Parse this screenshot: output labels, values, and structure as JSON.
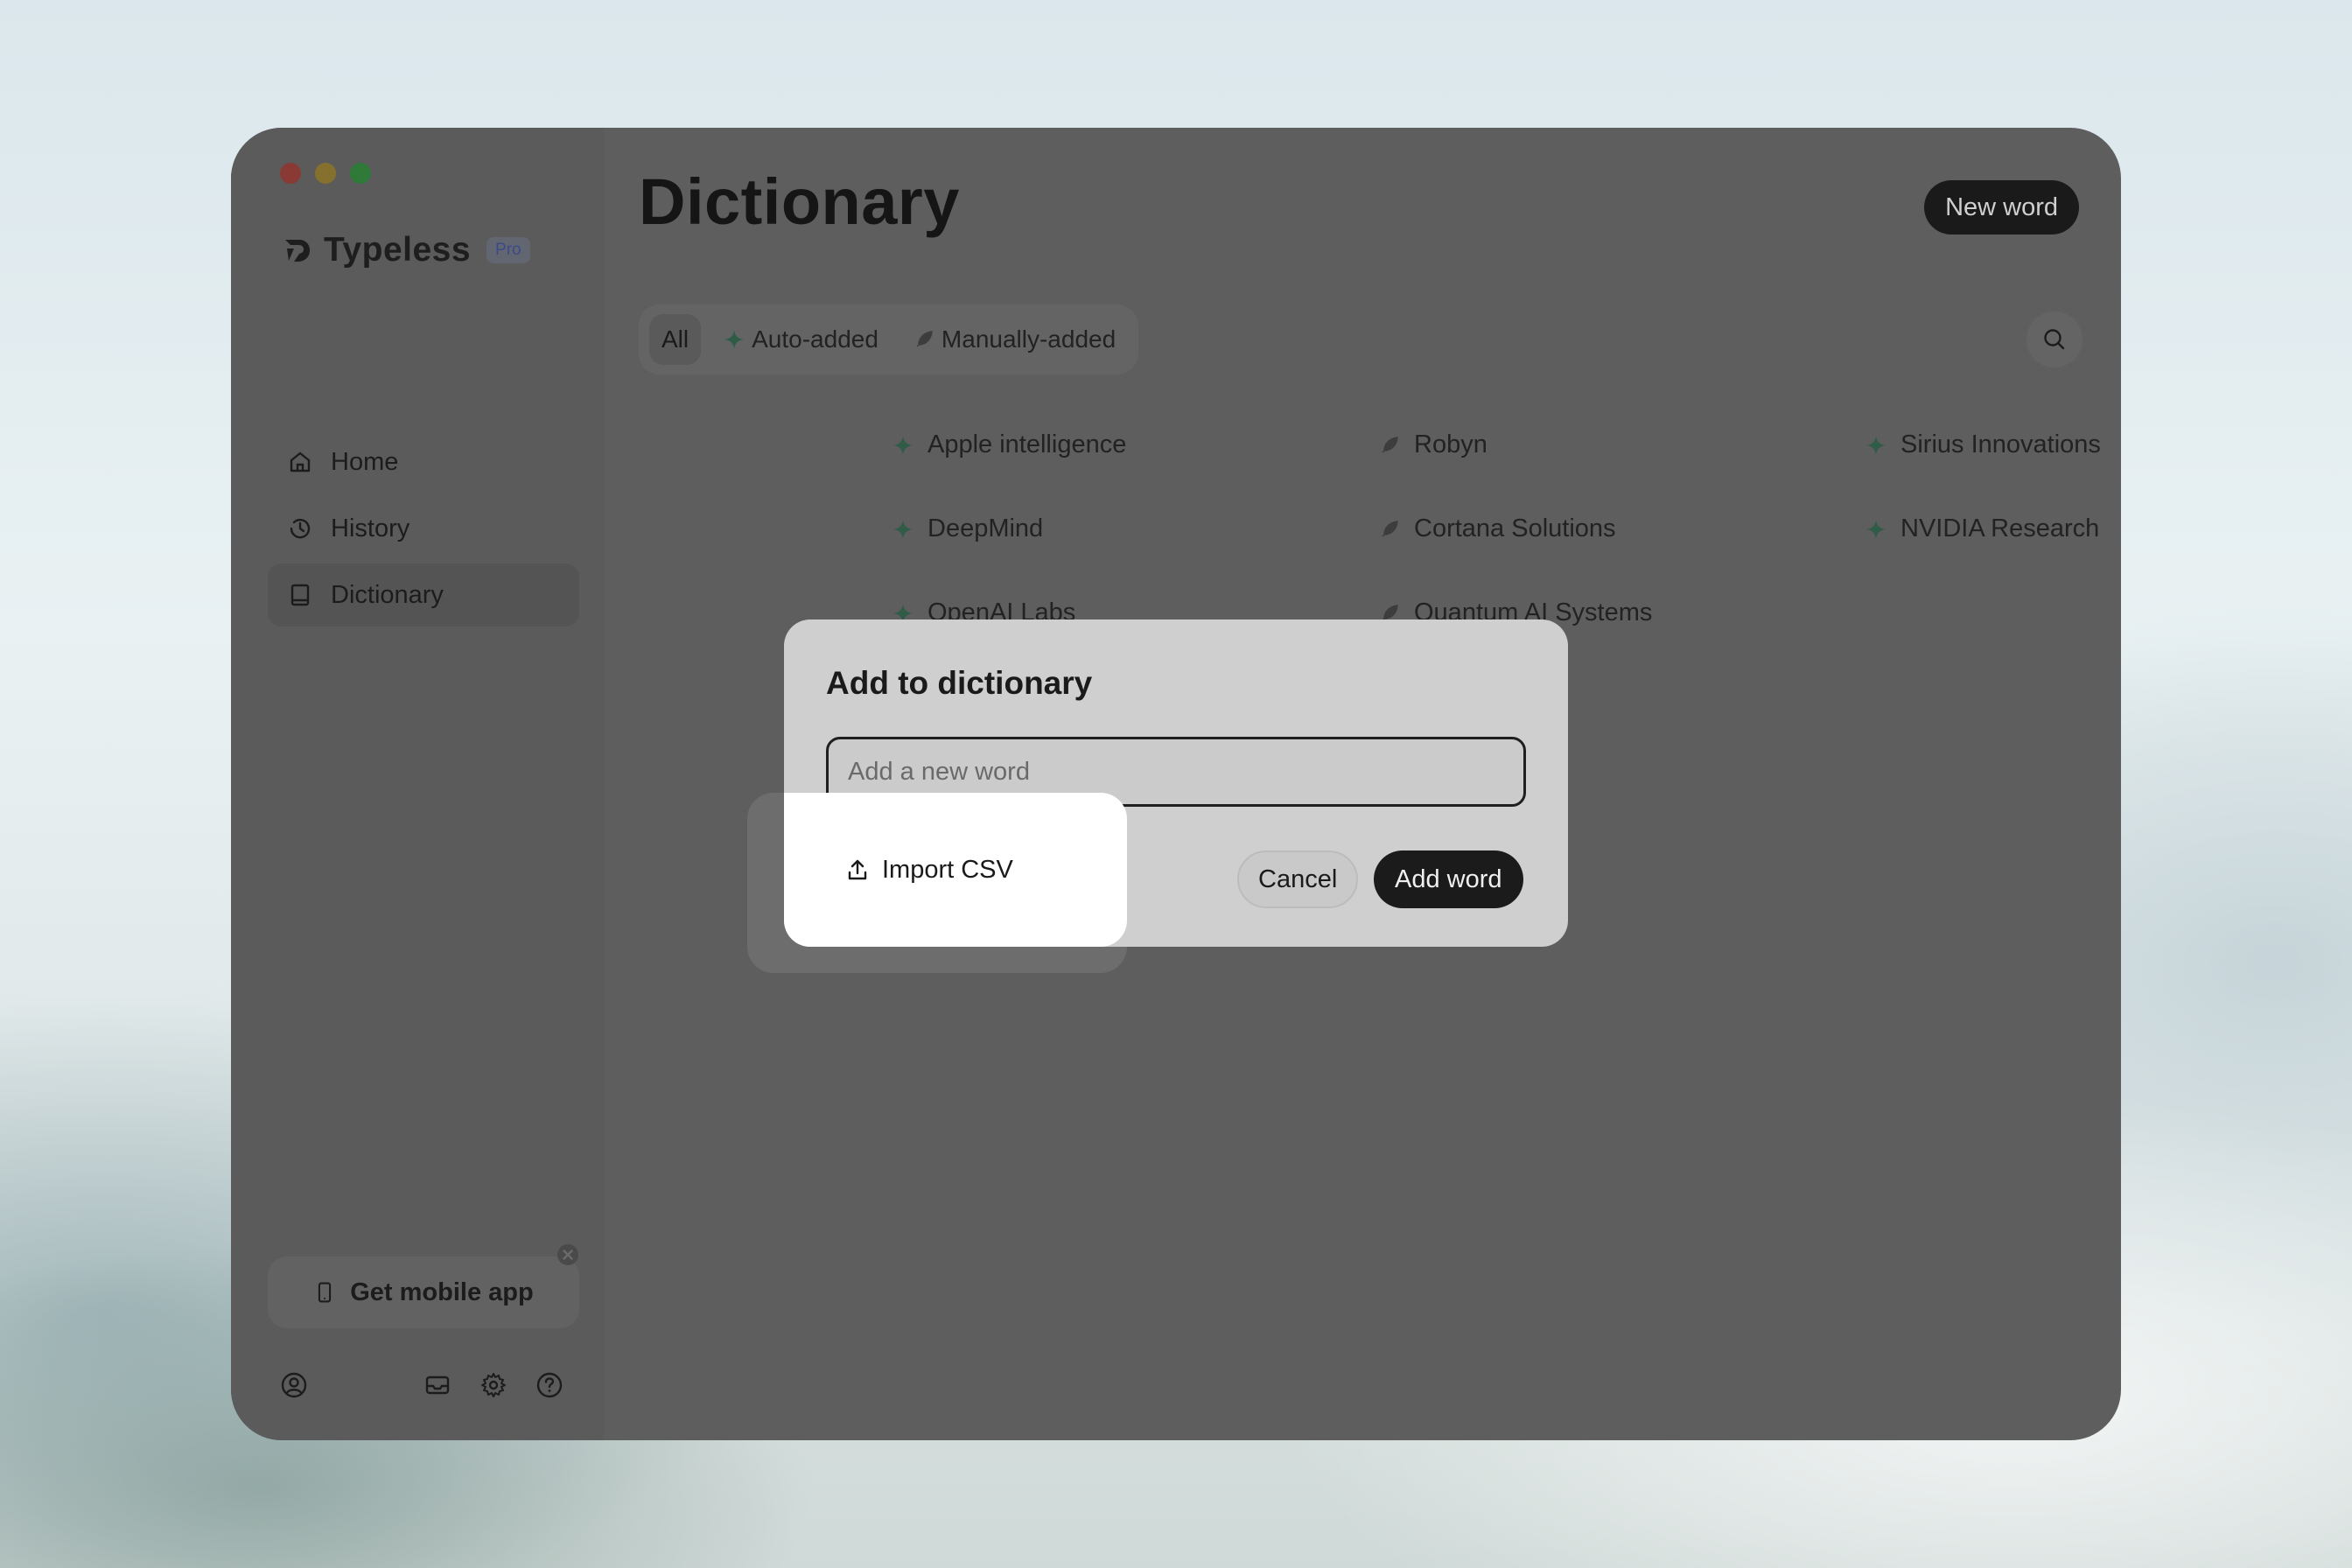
{
  "app": {
    "name": "Typeless",
    "badge": "Pro"
  },
  "sidebar": {
    "items": [
      {
        "label": "Home",
        "icon": "home-icon"
      },
      {
        "label": "History",
        "icon": "history-icon"
      },
      {
        "label": "Dictionary",
        "icon": "book-icon",
        "active": true
      }
    ],
    "mobile_card": {
      "label": "Get mobile app",
      "icon": "phone-icon"
    },
    "footer_icons": [
      "account-icon",
      "mail-icon",
      "gear-icon",
      "help-icon"
    ]
  },
  "main": {
    "title": "Dictionary",
    "new_word_label": "New word",
    "filters": [
      {
        "label": "All",
        "active": true
      },
      {
        "label": "Auto-added",
        "icon": "sparkle-icon"
      },
      {
        "label": "Manually-added",
        "icon": "feather-icon"
      }
    ],
    "words": [
      {
        "text": "Apple intelligence",
        "type": "auto"
      },
      {
        "text": "Robyn",
        "type": "manual"
      },
      {
        "text": "Sirius Innovations",
        "type": "auto"
      },
      {
        "text": "DeepMind",
        "type": "auto"
      },
      {
        "text": "Cortana Solutions",
        "type": "manual"
      },
      {
        "text": "NVIDIA Research",
        "type": "auto"
      },
      {
        "text": "OpenAI Labs",
        "type": "auto"
      },
      {
        "text": "Quantum AI Systems",
        "type": "manual"
      }
    ]
  },
  "dialog": {
    "title": "Add to dictionary",
    "input_placeholder": "Add a new word",
    "input_value": "",
    "import_label": "Import CSV",
    "cancel_label": "Cancel",
    "add_label": "Add word"
  },
  "colors": {
    "accent_auto": "#2f5c47",
    "primary_button": "#1b1b1b"
  }
}
